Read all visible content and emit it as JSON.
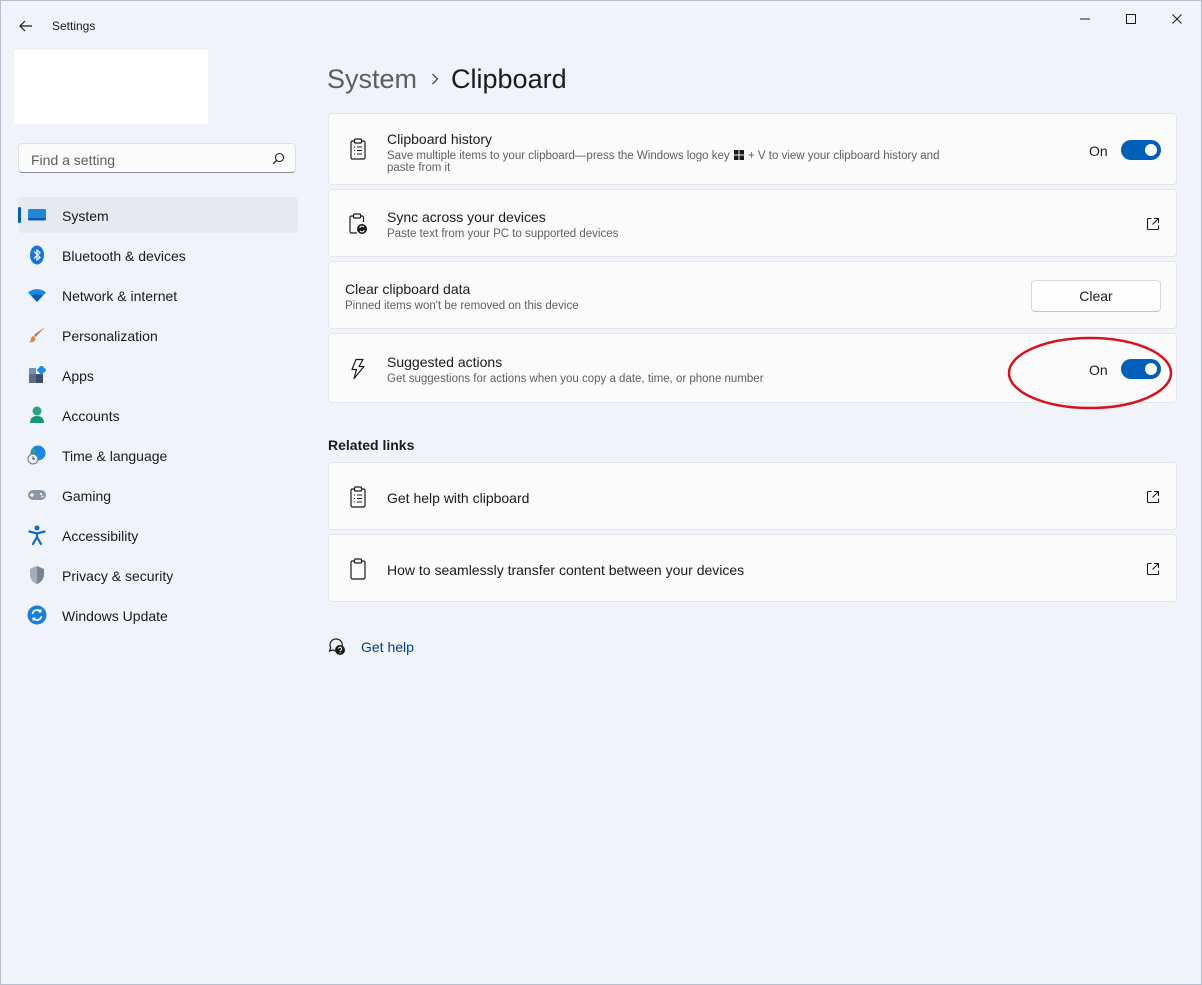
{
  "window": {
    "title": "Settings"
  },
  "search": {
    "placeholder": "Find a setting"
  },
  "nav": {
    "items": [
      {
        "label": "System",
        "icon": "system-monitor-icon",
        "active": true
      },
      {
        "label": "Bluetooth & devices",
        "icon": "bluetooth-icon"
      },
      {
        "label": "Network & internet",
        "icon": "wifi-icon"
      },
      {
        "label": "Personalization",
        "icon": "paintbrush-icon"
      },
      {
        "label": "Apps",
        "icon": "apps-icon"
      },
      {
        "label": "Accounts",
        "icon": "person-icon"
      },
      {
        "label": "Time & language",
        "icon": "globe-clock-icon"
      },
      {
        "label": "Gaming",
        "icon": "gamepad-icon"
      },
      {
        "label": "Accessibility",
        "icon": "accessibility-icon"
      },
      {
        "label": "Privacy & security",
        "icon": "shield-icon"
      },
      {
        "label": "Windows Update",
        "icon": "update-icon"
      }
    ]
  },
  "breadcrumb": {
    "parent": "System",
    "current": "Clipboard"
  },
  "settings": {
    "history": {
      "title": "Clipboard history",
      "desc_part1": "Save multiple items to your clipboard—press the Windows logo key",
      "desc_part2": " + V to view your clipboard history and",
      "desc_line2": "paste from it",
      "state": "On"
    },
    "sync": {
      "title": "Sync across your devices",
      "desc": "Paste text from your PC to supported devices"
    },
    "clear": {
      "title": "Clear clipboard data",
      "desc": "Pinned items won't be removed on this device",
      "button": "Clear"
    },
    "suggested": {
      "title": "Suggested actions",
      "desc": "Get suggestions for actions when you copy a date, time, or phone number",
      "state": "On"
    }
  },
  "related": {
    "heading": "Related links",
    "links": [
      {
        "label": "Get help with clipboard"
      },
      {
        "label": "How to seamlessly transfer content between your devices"
      }
    ]
  },
  "help": {
    "label": "Get help"
  },
  "colors": {
    "accent": "#005fb8",
    "link": "#003e92",
    "annotation": "#d4141c"
  }
}
